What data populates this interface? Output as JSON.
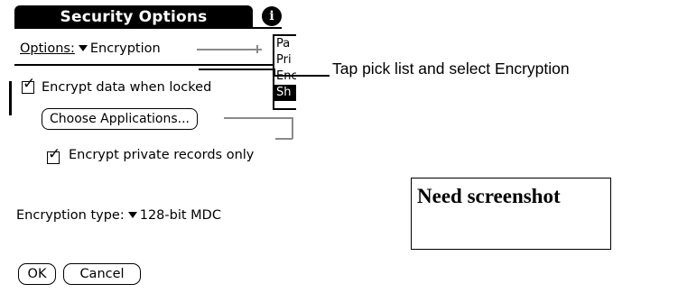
{
  "dialog": {
    "title": "Security Options",
    "info_icon": "i",
    "options_label": "Options:",
    "options_value": "Encryption",
    "picklist_items": [
      "Pa",
      "Pri",
      "Enc",
      "Sh"
    ],
    "encrypt_locked_label": "Encrypt data when locked",
    "encrypt_locked_checked": true,
    "choose_apps_label": "Choose Applications...",
    "encrypt_private_label": "Encrypt private records only",
    "encrypt_private_checked": true,
    "encryption_type_label": "Encryption type:",
    "encryption_type_value": "128-bit MDC",
    "ok_label": "OK",
    "cancel_label": "Cancel"
  },
  "annotation": {
    "callout": "Tap pick list and select Encryption",
    "placeholder": "Need screenshot"
  },
  "colors": {
    "background": "#ffffff",
    "ink": "#000000",
    "connector_gray": "#8a8a8a"
  }
}
